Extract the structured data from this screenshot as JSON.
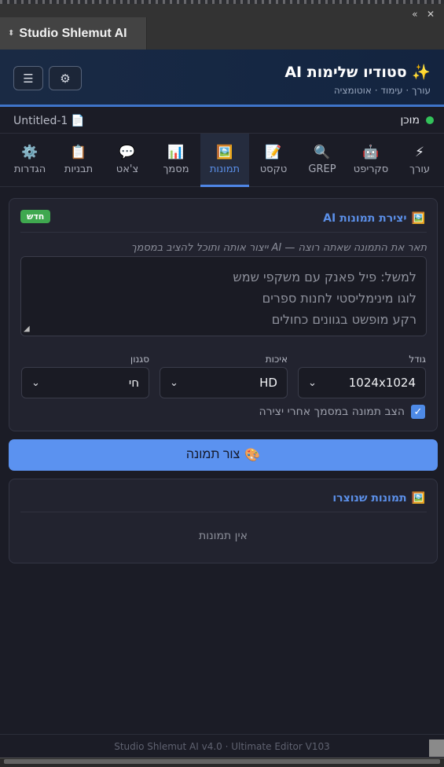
{
  "chrome": {
    "panel_title": "Studio Shlemut AI",
    "close_glyph": "✕",
    "collapse_glyph": "«"
  },
  "header": {
    "title": "סטודיו שלימות AI",
    "title_icon": "✨",
    "subtitle": "עורך · עימוד · אוטומציה",
    "menu_icon": "☰",
    "settings_icon": "⚙"
  },
  "status": {
    "document": "Untitled-1",
    "state": "מוכן",
    "state_color": "#33c25a"
  },
  "tabs": [
    {
      "icon": "⚡",
      "label": "עורך"
    },
    {
      "icon": "🤖",
      "label": "סקריפט"
    },
    {
      "icon": "🔍",
      "label": "GREP"
    },
    {
      "icon": "📝",
      "label": "טקסט"
    },
    {
      "icon": "🖼️",
      "label": "תמונות",
      "active": true
    },
    {
      "icon": "📊",
      "label": "מסמך"
    },
    {
      "icon": "💬",
      "label": "צ'אט"
    },
    {
      "icon": "📋",
      "label": "תבניות"
    },
    {
      "icon": "⚙️",
      "label": "הגדרות"
    }
  ],
  "image_gen": {
    "title": "יצירת תמונות AI",
    "title_icon": "🖼️",
    "badge": "חדש",
    "hint": "תאר את התמונה שאתה רוצה — AI ייצור אותה ותוכל להציב במסמך",
    "placeholder": "למשל: פיל פאנק עם משקפי שמש\nלוגו מינימליסטי לחנות ספרים\nרקע מופשט בגוונים כחולים",
    "size_label": "גודל",
    "size_value": "1024x1024",
    "quality_label": "איכות",
    "quality_value": "HD",
    "style_label": "סגנון",
    "style_value": "חי",
    "place_checkbox_label": "הצב תמונה במסמך אחרי יצירה",
    "place_checked": true
  },
  "generate_button": {
    "icon": "🎨",
    "label": "צור תמונה"
  },
  "generated": {
    "title": "תמונות שנוצרו",
    "title_icon": "🖼️",
    "empty_text": "אין תמונות"
  },
  "footer": {
    "text": "Studio Shlemut AI v4.0 · Ultimate Editor V103"
  },
  "accent_color": "#4f86e6"
}
